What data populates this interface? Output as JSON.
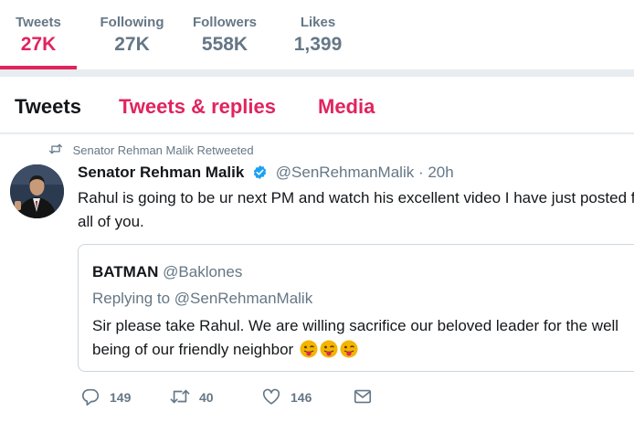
{
  "stats": [
    {
      "label": "Tweets",
      "value": "27K",
      "active": true
    },
    {
      "label": "Following",
      "value": "27K",
      "active": false
    },
    {
      "label": "Followers",
      "value": "558K",
      "active": false
    },
    {
      "label": "Likes",
      "value": "1,399",
      "active": false
    }
  ],
  "tabs": {
    "tweets": "Tweets",
    "replies": "Tweets & replies",
    "media": "Media"
  },
  "colors": {
    "accent": "#e0245e",
    "verified": "#1da1f2",
    "secondary_text": "#657786"
  },
  "tweet": {
    "retweet_context": "Senator Rehman Malik Retweeted",
    "author_name": "Senator Rehman Malik",
    "author_handle": "@SenRehmanMalik",
    "time": "· 20h",
    "text": "Rahul is going to be ur next PM and watch his excellent video I have just posted for all of you.",
    "quoted": {
      "name": "BATMAN",
      "handle": "@Baklones",
      "replying_to": "Replying to @SenRehmanMalik",
      "text": "Sir please take Rahul. We are willing sacrifice our beloved leader for the well being of our friendly neighbor",
      "emoji_count": 3
    },
    "actions": {
      "replies": "149",
      "retweets": "40",
      "likes": "146"
    }
  }
}
